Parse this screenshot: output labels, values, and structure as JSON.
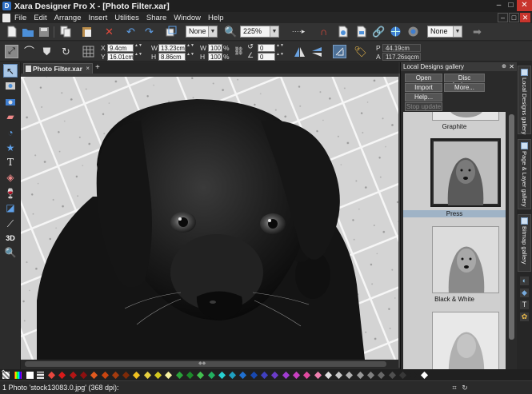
{
  "window": {
    "title": "Xara Designer Pro X - [Photo Filter.xar]",
    "app_icon_letter": "D",
    "minimize": "–",
    "maximize": "□",
    "close": "✕"
  },
  "menu": {
    "items": [
      "File",
      "Edit",
      "Arrange",
      "Insert",
      "Utilities",
      "Share",
      "Window",
      "Help"
    ]
  },
  "toolbar1": {
    "quality_value": "None",
    "zoom_value": "225%",
    "fill_value": "None"
  },
  "toolbar2": {
    "x_label": "X",
    "x_value": "9.4cm",
    "y_label": "Y",
    "y_value": "16.01cm",
    "w_label": "W",
    "w_value": "13.23cm",
    "h_label": "H",
    "h_value": "8.86cm",
    "w_pct": "100",
    "h_pct": "100",
    "pct_sign": "%",
    "rot_value": "0",
    "skew_value": "0",
    "p_label": "P",
    "p_value": "44.19cm",
    "a_label": "A",
    "a_value": "117.26sqcm"
  },
  "document": {
    "tab_label": "Photo Filter.xar",
    "tab_close": "×",
    "new_tab": "+"
  },
  "gallery": {
    "title": "Local Designs gallery",
    "buttons": {
      "open": "Open",
      "disc": "Disc designs...",
      "import": "Import",
      "more": "More...",
      "help": "Help...",
      "stop": "Stop update"
    },
    "items": [
      {
        "label": "Graphite"
      },
      {
        "label": "Press"
      },
      {
        "label": "Black & White"
      }
    ]
  },
  "right_tabs": {
    "local_designs": "Local Designs gallery",
    "page_layer": "Page & Layer gallery",
    "bitmap": "Bitmap gallery"
  },
  "status": {
    "text": "1 Photo 'stock13083.0.jpg' (368 dpi):"
  },
  "palette": {
    "colors": [
      "#e8483f",
      "#d81a1a",
      "#b31515",
      "#8c1010",
      "#e15a1f",
      "#c94510",
      "#a53b0e",
      "#7e2a08",
      "#f0c020",
      "#e8d040",
      "#d4c820",
      "#f5f0a0",
      "#2aa43a",
      "#1c8a2a",
      "#44c050",
      "#22b060",
      "#28d0d0",
      "#20a0c0",
      "#2070d0",
      "#1848b0",
      "#4040c0",
      "#6a3cc8",
      "#a03cd0",
      "#c840c0",
      "#e04aa0",
      "#f080b0",
      "#e0e0e0",
      "#c8c8c8",
      "#b0b0b0",
      "#989898",
      "#808080",
      "#686868",
      "#505050",
      "#383838",
      "#202020",
      "#ffffff"
    ]
  }
}
